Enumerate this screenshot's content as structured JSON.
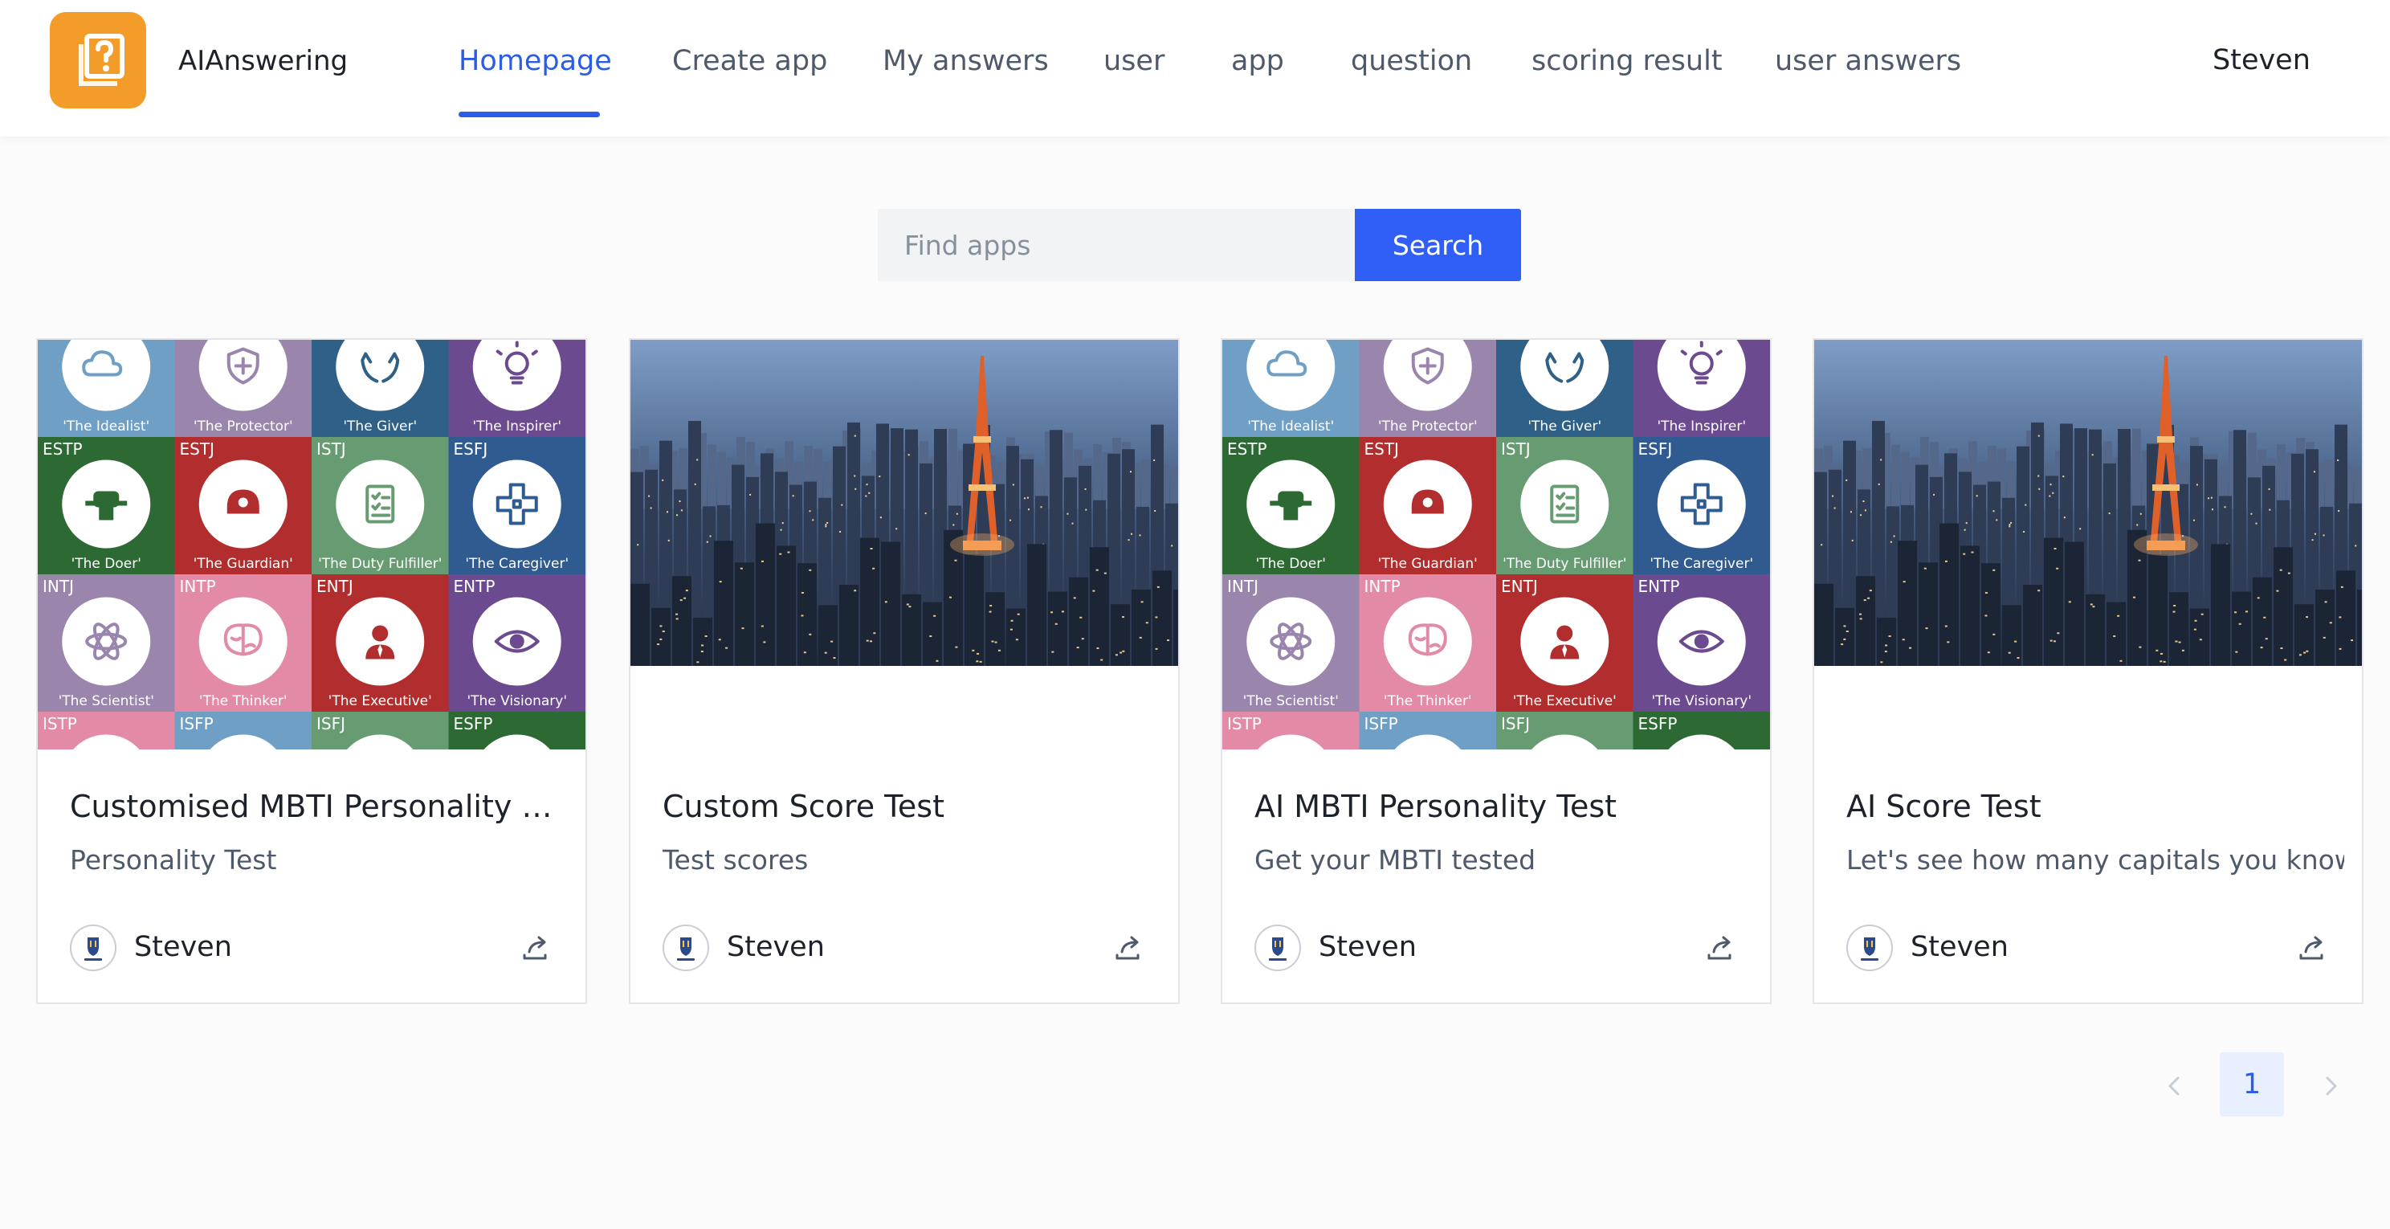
{
  "header": {
    "app_title": "AIAnswering",
    "logo_icon": "question-mark-icon",
    "nav": [
      {
        "label": "Homepage",
        "active": true
      },
      {
        "label": "Create app"
      },
      {
        "label": "My answers"
      },
      {
        "label": "user"
      },
      {
        "label": "app"
      },
      {
        "label": "question"
      },
      {
        "label": "scoring result"
      },
      {
        "label": "user answers"
      }
    ],
    "user_name": "Steven"
  },
  "search": {
    "placeholder": "Find apps",
    "button_label": "Search"
  },
  "cards": [
    {
      "title": "Customised MBTI Personality Test",
      "description": "Personality Test",
      "author": "Steven",
      "cover": "mbti-grid-image"
    },
    {
      "title": "Custom Score Test",
      "description": "Test scores",
      "author": "Steven",
      "cover": "city-tower-night-image"
    },
    {
      "title": "AI MBTI Personality Test",
      "description": "Get your MBTI tested",
      "author": "Steven",
      "cover": "mbti-grid-image"
    },
    {
      "title": "AI Score Test",
      "description": "Let's see how many capitals you know",
      "author": "Steven",
      "cover": "city-tower-night-image"
    }
  ],
  "mbti_tiles": [
    {
      "code": "",
      "label": "'The Idealist'",
      "color": "#6f9fc4",
      "icon": "cloud"
    },
    {
      "code": "",
      "label": "'The Protector'",
      "color": "#9a86ad",
      "icon": "shield"
    },
    {
      "code": "",
      "label": "'The Giver'",
      "color": "#2f6088",
      "icon": "hands"
    },
    {
      "code": "",
      "label": "'The Inspirer'",
      "color": "#6c4a8f",
      "icon": "bulb"
    },
    {
      "code": "ESTP",
      "label": "'The Doer'",
      "color": "#2d6a33",
      "icon": "fist"
    },
    {
      "code": "ESTJ",
      "label": "'The Guardian'",
      "color": "#b22d2d",
      "icon": "helmet"
    },
    {
      "code": "ISTJ",
      "label": "'The Duty Fulfiller'",
      "color": "#679b72",
      "icon": "list"
    },
    {
      "code": "ESFJ",
      "label": "'The Caregiver'",
      "color": "#2f5b90",
      "icon": "cross"
    },
    {
      "code": "INTJ",
      "label": "'The Scientist'",
      "color": "#9a86ad",
      "icon": "atom"
    },
    {
      "code": "INTP",
      "label": "'The Thinker'",
      "color": "#e28aa6",
      "icon": "brain"
    },
    {
      "code": "ENTJ",
      "label": "'The Executive'",
      "color": "#b22d2d",
      "icon": "person"
    },
    {
      "code": "ENTP",
      "label": "'The Visionary'",
      "color": "#6c4a8f",
      "icon": "eye"
    },
    {
      "code": "ISTP",
      "label": "",
      "color": "#e28aa6",
      "icon": ""
    },
    {
      "code": "ISFP",
      "label": "",
      "color": "#6f9fc4",
      "icon": ""
    },
    {
      "code": "ISFJ",
      "label": "",
      "color": "#679b72",
      "icon": ""
    },
    {
      "code": "ESFP",
      "label": "",
      "color": "#2d6a33",
      "icon": ""
    }
  ],
  "pagination": {
    "current_page": "1",
    "prev_icon": "chevron-left-icon",
    "next_icon": "chevron-right-icon"
  },
  "colors": {
    "primary": "#2f5ff6",
    "logo_bg": "#f39c2a"
  }
}
